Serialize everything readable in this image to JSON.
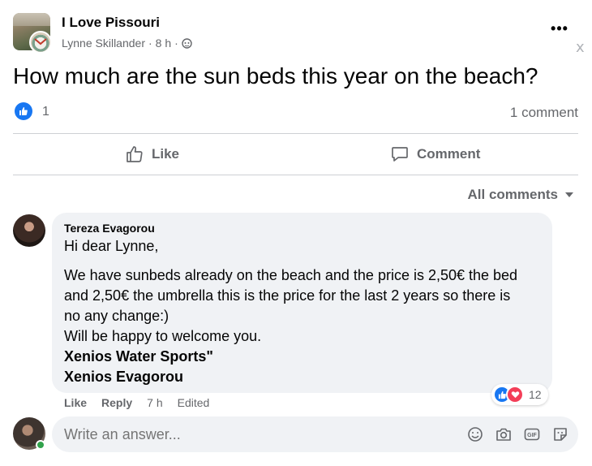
{
  "post": {
    "group_name": "I Love Pissouri",
    "author": "Lynne Skillander",
    "time": "8 h",
    "sep1": "·",
    "sep2": "·",
    "more": "•••",
    "close": "x",
    "text": "How much are the sun beds this year on the beach?",
    "reaction_count": "1",
    "comment_count": "1 comment"
  },
  "actions": {
    "like_label": "Like",
    "comment_label": "Comment"
  },
  "comments_filter": "All comments",
  "comment": {
    "author": "Tereza Evagorou",
    "lines": [
      "Hi dear Lynne,",
      "We have sunbeds already on the beach and the price is 2,50€ the bed",
      "and 2,50€ the umbrella this is the price for the last 2 years so there is",
      "no any change:)",
      "Will be happy to welcome you.",
      "Xenios Water Sports\"",
      "Xenios Evagorou"
    ],
    "like_label": "Like",
    "reply_label": "Reply",
    "time": "7 h",
    "edited": "Edited",
    "reaction_count": "12"
  },
  "answer": {
    "placeholder": "Write an answer..."
  },
  "colors": {
    "brand_blue": "#1877f2",
    "love_red": "#f33e58",
    "online_green": "#31a24c",
    "secondary_text": "#65676b",
    "bubble_bg": "#f0f2f5"
  },
  "icons": [
    "globe-icon",
    "like-icon",
    "comment-icon",
    "chevron-down-icon",
    "emoji-icon",
    "camera-icon",
    "gif-icon",
    "sticker-icon"
  ]
}
